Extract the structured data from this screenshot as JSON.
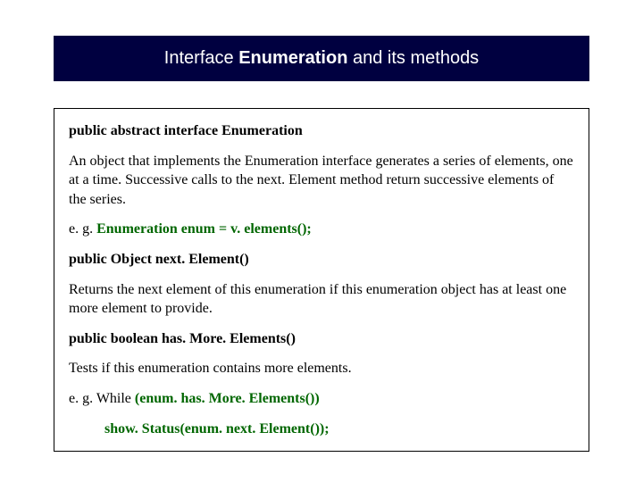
{
  "title": {
    "prefix": "Interface ",
    "bold": "Enumeration",
    "suffix": " and its methods"
  },
  "content": {
    "declaration": "public abstract interface Enumeration",
    "description": "An object that implements the Enumeration interface generates a series of elements, one at a time. Successive calls to the next. Element method return successive elements of the series.",
    "example1_prefix": "e. g. ",
    "example1_code": "Enumeration enum = v. elements();",
    "method1_sig": "public Object next. Element()",
    "method1_desc": "Returns the next element of this enumeration if this enumeration object has at least one more element to provide.",
    "method2_sig": "public boolean has. More. Elements()",
    "method2_desc": "Tests if this enumeration contains more elements.",
    "example2_prefix": "e. g.  While ",
    "example2_code": "(enum. has. More. Elements())",
    "example3_code": "show. Status(enum. next. Element());"
  }
}
